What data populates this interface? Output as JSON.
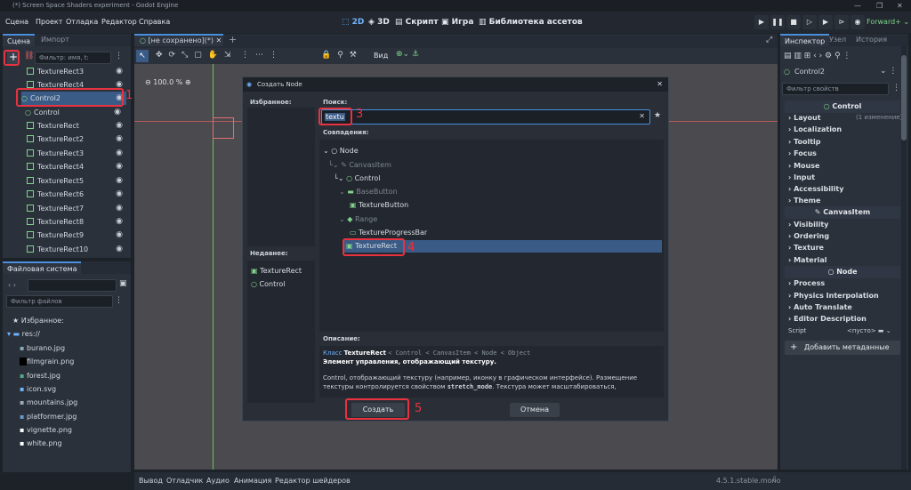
{
  "window": {
    "title": "(*) Screen Space Shaders experiment - Godot Engine",
    "controls": [
      "—",
      "❐",
      "✕"
    ]
  },
  "menu": [
    "Сцена",
    "Проект",
    "Отладка",
    "Редактор",
    "Справка"
  ],
  "main_buttons": [
    {
      "label": "2D",
      "icon": "2d-icon"
    },
    {
      "label": "3D",
      "icon": "3d-icon"
    },
    {
      "label": "Скрипт",
      "icon": "script-icon"
    },
    {
      "label": "Игра",
      "icon": "game-icon"
    },
    {
      "label": "Библиотека ассетов",
      "icon": "assetlib-icon"
    }
  ],
  "renderer": "Forward+",
  "scene_dock": {
    "tabs": [
      "Сцена",
      "Импорт"
    ],
    "filter_placeholder": "Фильтр: имя, t:",
    "rows": [
      "TextureRect3",
      "TextureRect4",
      "Control2",
      "Control",
      "TextureRect",
      "TextureRect2",
      "TextureRect3",
      "TextureRect4",
      "TextureRect5",
      "TextureRect6",
      "TextureRect7",
      "TextureRect8",
      "TextureRect9",
      "TextureRect10"
    ]
  },
  "filesystem": {
    "tab": "Файловая система",
    "path": "",
    "filter_placeholder": "Фильтр файлов",
    "favorites": "Избранное:",
    "root": "res://",
    "files": [
      "burano.jpg",
      "filmgrain.png",
      "forest.jpg",
      "icon.svg",
      "mountains.jpg",
      "platformer.jpg",
      "vignette.png",
      "white.png"
    ]
  },
  "editor_tab": "[не сохранено](*)",
  "viewport": {
    "zoom": "100.0 %",
    "view": "Вид"
  },
  "bottom_panel": {
    "tabs": [
      "Вывод",
      "Отладчик",
      "Аудио",
      "Анимация",
      "Редактор шейдеров"
    ],
    "version": "4.5.1.stable.mono"
  },
  "inspector": {
    "tabs": [
      "Инспектор",
      "Узел",
      "История"
    ],
    "node_name": "Control2",
    "filter_placeholder": "Фильтр свойств",
    "sections": [
      {
        "header": "Control",
        "rows": [
          "Layout",
          "Localization",
          "Tooltip",
          "Focus",
          "Mouse",
          "Input",
          "Accessibility",
          "Theme"
        ]
      },
      {
        "header": "CanvasItem",
        "rows": [
          "Visibility",
          "Ordering",
          "Texture",
          "Material"
        ]
      },
      {
        "header": "Node",
        "rows": [
          "Process",
          "Physics Interpolation",
          "Auto Translate",
          "Editor Description"
        ]
      }
    ],
    "layout_note": "(1 изменение)",
    "script_label": "Script",
    "script_value": "<пусто>",
    "add_meta": "Добавить метаданные"
  },
  "dialog": {
    "title": "Создать Node",
    "favorites": "Избранное:",
    "recent": "Недавнее:",
    "recent_items": [
      "TextureRect",
      "Control"
    ],
    "search_label": "Поиск:",
    "search_value": "textu",
    "matches": "Совпадения:",
    "tree": [
      {
        "label": "Node",
        "dim": false
      },
      {
        "label": "CanvasItem",
        "dim": true
      },
      {
        "label": "Control",
        "dim": false
      },
      {
        "label": "BaseButton",
        "dim": true
      },
      {
        "label": "TextureButton",
        "dim": false
      },
      {
        "label": "Range",
        "dim": true
      },
      {
        "label": "TextureProgressBar",
        "dim": false
      },
      {
        "label": "TextureRect",
        "dim": false
      }
    ],
    "description_label": "Описание:",
    "desc_class_prefix": "Класс",
    "desc_class": "TextureRect",
    "desc_chain": "< Control < CanvasItem < Node < Object",
    "desc_bold": "Элемент управления, отображающий текстуру.",
    "desc_text": "Control, отображающий текстуру (например, иконку в графическом интерфейсе). Размещение текстуры контролируется свойством",
    "desc_code": "stretch_mode",
    "desc_tail": ". Текстура может масштабироваться,",
    "create": "Создать",
    "cancel": "Отмена"
  },
  "annotations": [
    "1",
    "3",
    "4",
    "5"
  ]
}
